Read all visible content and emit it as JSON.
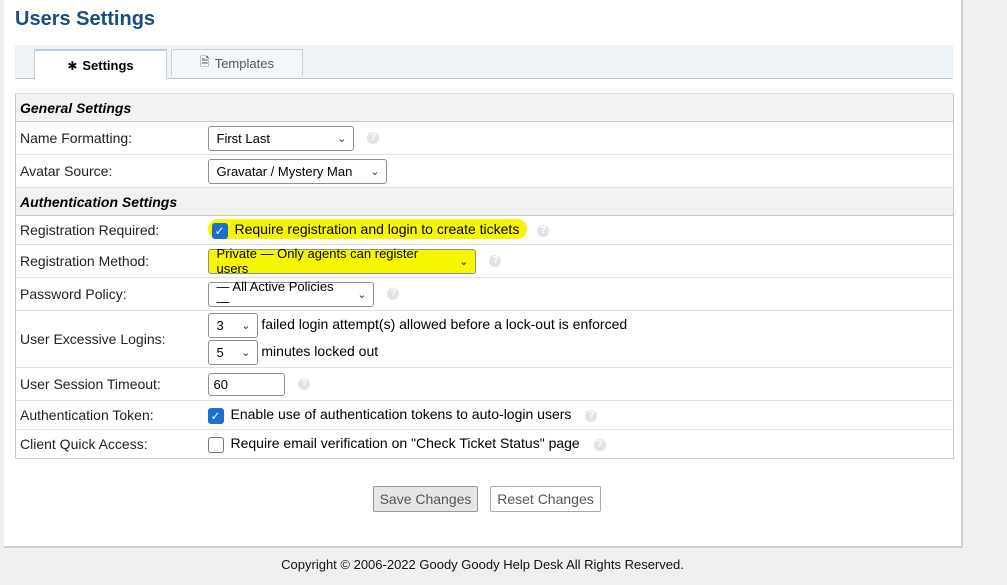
{
  "page": {
    "title": "Users Settings"
  },
  "tabs": [
    {
      "label": "Settings",
      "icon": "asterisk-icon"
    },
    {
      "label": "Templates",
      "icon": "file-icon"
    }
  ],
  "sections": {
    "general": "General Settings",
    "auth": "Authentication Settings"
  },
  "fields": {
    "name_formatting": {
      "label": "Name Formatting:",
      "value": "First Last"
    },
    "avatar_source": {
      "label": "Avatar Source:",
      "value": "Gravatar / Mystery Man"
    },
    "registration_required": {
      "label": "Registration Required:",
      "checked": true,
      "text": "Require registration and login to create tickets"
    },
    "registration_method": {
      "label": "Registration Method:",
      "value": "Private — Only agents can register users"
    },
    "password_policy": {
      "label": "Password Policy:",
      "value": "— All Active Policies —"
    },
    "excessive_logins": {
      "label": "User Excessive Logins:",
      "attempts_value": "3",
      "attempts_text": "failed login attempt(s) allowed before a lock-out is enforced",
      "minutes_value": "5",
      "minutes_text": "minutes locked out"
    },
    "session_timeout": {
      "label": "User Session Timeout:",
      "value": "60"
    },
    "auth_token": {
      "label": "Authentication Token:",
      "checked": true,
      "text": "Enable use of authentication tokens to auto-login users"
    },
    "quick_access": {
      "label": "Client Quick Access:",
      "checked": false,
      "text": "Require email verification on \"Check Ticket Status\" page"
    }
  },
  "buttons": {
    "save": "Save Changes",
    "reset": "Reset Changes"
  },
  "footer": "Copyright © 2006-2022 Goody Goody Help Desk All Rights Reserved.",
  "colors": {
    "title": "#184e81",
    "highlight": "#f7f600",
    "checkbox": "#1a6fd1"
  }
}
